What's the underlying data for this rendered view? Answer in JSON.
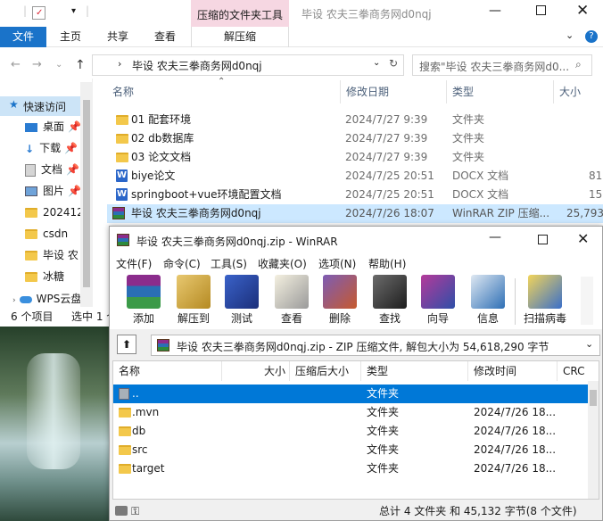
{
  "explorer": {
    "title_tools_label": "压缩的文件夹工具",
    "title_path": "毕设 农夫三拳商务网d0nqj",
    "ribbon_tabs": [
      "文件",
      "主页",
      "共享",
      "查看"
    ],
    "ribbon_context_tab": "解压缩",
    "address": "毕设 农夫三拳商务网d0nqj",
    "search_placeholder": "搜索\"毕设 农夫三拳商务网d0...",
    "quick_access": "快速访问",
    "sidebar": [
      {
        "label": "桌面",
        "icon": "desktop-icon"
      },
      {
        "label": "下载",
        "icon": "download-icon"
      },
      {
        "label": "文档",
        "icon": "documents-icon"
      },
      {
        "label": "图片",
        "icon": "pictures-icon"
      },
      {
        "label": "202412",
        "icon": "folder-icon"
      },
      {
        "label": "csdn",
        "icon": "folder-icon"
      },
      {
        "label": "毕设 农",
        "icon": "folder-icon"
      },
      {
        "label": "冰糖",
        "icon": "folder-icon"
      },
      {
        "label": "WPS云盘",
        "icon": "cloud-icon"
      }
    ],
    "columns": {
      "name": "名称",
      "date": "修改日期",
      "type": "类型",
      "size": "大小"
    },
    "files": [
      {
        "name": "01 配套环境",
        "date": "2024/7/27 9:39",
        "type": "文件夹",
        "size": "",
        "icon": "folder"
      },
      {
        "name": "02 db数据库",
        "date": "2024/7/27 9:39",
        "type": "文件夹",
        "size": "",
        "icon": "folder"
      },
      {
        "name": "03 论文文档",
        "date": "2024/7/27 9:39",
        "type": "文件夹",
        "size": "",
        "icon": "folder"
      },
      {
        "name": "biye论文",
        "date": "2024/7/25 20:51",
        "type": "DOCX 文档",
        "size": "81",
        "icon": "docx"
      },
      {
        "name": "springboot+vue环境配置文档",
        "date": "2024/7/25 20:51",
        "type": "DOCX 文档",
        "size": "15",
        "icon": "docx"
      },
      {
        "name": "毕设 农夫三拳商务网d0nqj",
        "date": "2024/7/26 18:07",
        "type": "WinRAR ZIP 压缩...",
        "size": "25,793",
        "icon": "rar"
      }
    ],
    "status_count": "6 个项目",
    "status_selected": "选中 1 个"
  },
  "winrar": {
    "title": "毕设 农夫三拳商务网d0nqj.zip - WinRAR",
    "menu": [
      "文件(F)",
      "命令(C)",
      "工具(S)",
      "收藏夹(O)",
      "选项(N)",
      "帮助(H)"
    ],
    "toolbar": [
      {
        "label": "添加",
        "icon": "add-archive-icon",
        "color": "#7a3e8c"
      },
      {
        "label": "解压到",
        "icon": "extract-to-icon",
        "color": "#c99a2e"
      },
      {
        "label": "测试",
        "icon": "test-icon",
        "color": "#2e4fa8"
      },
      {
        "label": "查看",
        "icon": "view-icon",
        "color": "#8c8c8c"
      },
      {
        "label": "删除",
        "icon": "delete-icon",
        "color": "#b94a2e"
      },
      {
        "label": "查找",
        "icon": "find-icon",
        "color": "#4a4a4a"
      },
      {
        "label": "向导",
        "icon": "wizard-icon",
        "color": "#8c2e8c"
      },
      {
        "label": "信息",
        "icon": "info-icon",
        "color": "#2e6fb5"
      },
      {
        "label": "扫描病毒",
        "icon": "scan-virus-icon",
        "color": "#c9a62e"
      }
    ],
    "path": "毕设 农夫三拳商务网d0nqj.zip - ZIP 压缩文件, 解包大小为 54,618,290 字节",
    "columns": {
      "name": "名称",
      "size": "大小",
      "packed": "压缩后大小",
      "type": "类型",
      "modified": "修改时间",
      "crc": "CRC"
    },
    "rows": [
      {
        "name": "..",
        "type": "文件夹",
        "modified": "",
        "selected": true,
        "icon": "up"
      },
      {
        "name": ".mvn",
        "type": "文件夹",
        "modified": "2024/7/26 18...",
        "selected": false,
        "icon": "folder"
      },
      {
        "name": "db",
        "type": "文件夹",
        "modified": "2024/7/26 18...",
        "selected": false,
        "icon": "folder"
      },
      {
        "name": "src",
        "type": "文件夹",
        "modified": "2024/7/26 18...",
        "selected": false,
        "icon": "folder"
      },
      {
        "name": "target",
        "type": "文件夹",
        "modified": "2024/7/26 18...",
        "selected": false,
        "icon": "folder"
      }
    ],
    "status": "总计 4 文件夹 和 45,132 字节(8 个文件)"
  }
}
